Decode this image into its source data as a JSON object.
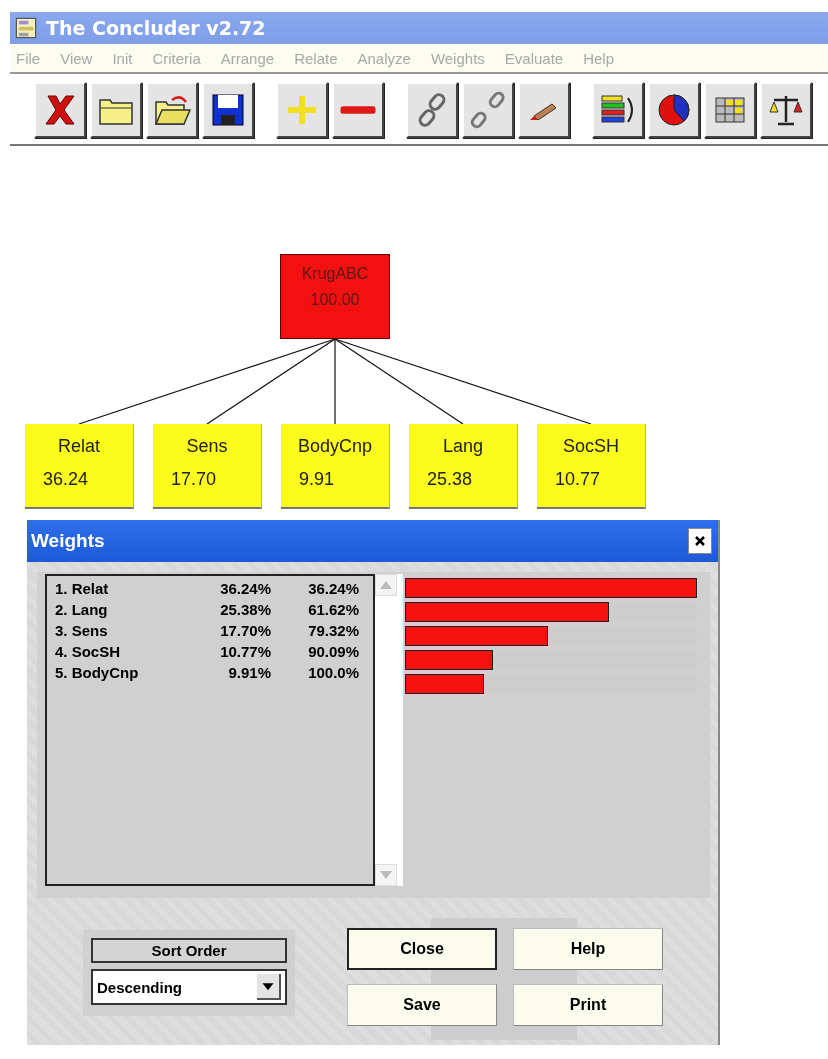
{
  "window": {
    "title": "The Concluder v2.72"
  },
  "menu": [
    {
      "label": "File",
      "disabled": true
    },
    {
      "label": "View",
      "disabled": true
    },
    {
      "label": "Init",
      "disabled": true
    },
    {
      "label": "Criteria",
      "disabled": true
    },
    {
      "label": "Arrange",
      "disabled": true
    },
    {
      "label": "Relate",
      "disabled": true
    },
    {
      "label": "Analyze",
      "disabled": true
    },
    {
      "label": "Weights",
      "disabled": true
    },
    {
      "label": "Evaluate",
      "disabled": true
    },
    {
      "label": "Help",
      "disabled": true
    }
  ],
  "tree": {
    "name": "KrugABC",
    "value": "100.00",
    "children": [
      {
        "name": "Relat",
        "value": "36.24"
      },
      {
        "name": "Sens",
        "value": "17.70"
      },
      {
        "name": "BodyCnp",
        "value": "9.91"
      },
      {
        "name": "Lang",
        "value": "25.38"
      },
      {
        "name": "SocSH",
        "value": "10.77"
      }
    ]
  },
  "weights_dialog": {
    "title": "Weights",
    "rows": [
      {
        "name": "1. Relat",
        "weight": "36.24%",
        "cumulative": "36.24%",
        "level": 1.0
      },
      {
        "name": "2. Lang",
        "weight": "25.38%",
        "cumulative": "61.62%",
        "level": 0.7
      },
      {
        "name": "3. Sens",
        "weight": "17.70%",
        "cumulative": "79.32%",
        "level": 0.49
      },
      {
        "name": "4. SocSH",
        "weight": "10.77%",
        "cumulative": "90.09%",
        "level": 0.3
      },
      {
        "name": "5. BodyCnp",
        "weight": "9.91%",
        "cumulative": "100.0%",
        "level": 0.27
      }
    ],
    "sort_order": {
      "label": "Sort Order",
      "value": "Descending"
    },
    "buttons": [
      {
        "label": "Close",
        "default": true
      },
      {
        "label": "Help",
        "default": false
      },
      {
        "label": "Save",
        "default": false
      },
      {
        "label": "Print",
        "default": false
      }
    ]
  }
}
